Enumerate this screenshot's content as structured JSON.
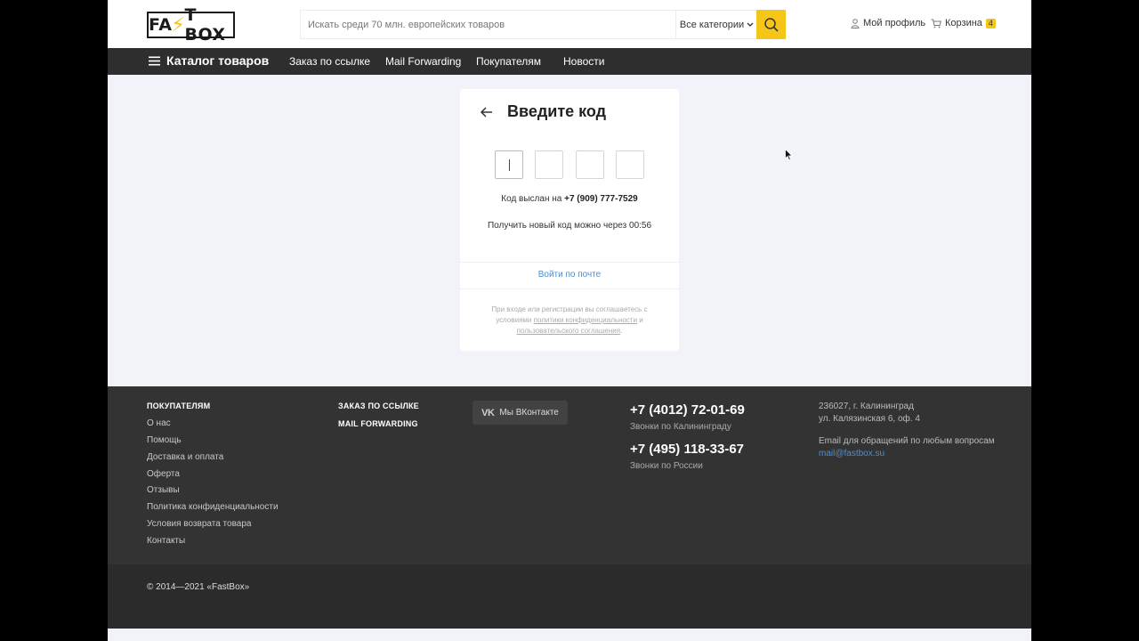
{
  "header": {
    "logo_left": "FA",
    "logo_bolt": "⚡",
    "logo_right": "T BOX",
    "search_placeholder": "Искать среди 70 млн. европейских товаров",
    "category_select": "Все категории",
    "profile": "Мой профиль",
    "cart": "Корзина",
    "cart_count": "4"
  },
  "nav": {
    "catalog": "Каталог товаров",
    "items": [
      "Заказ по ссылке",
      "Mail Forwarding",
      "Покупателям",
      "Новости"
    ]
  },
  "card": {
    "title": "Введите код",
    "sent_prefix": "Код выслан на",
    "phone": "+7 (909) 777-7529",
    "timer_text": "Получить новый код можно через 00:56",
    "email_login": "Войти по почте",
    "terms_1": "При входе или регистрации вы соглашаетесь с условиями",
    "terms_privacy": "политики конфиденциальности",
    "terms_and": "и",
    "terms_agreement": "пользовательского соглашения",
    "terms_end": "."
  },
  "footer": {
    "buyers_title": "ПОКУПАТЕЛЯМ",
    "buyers_links": [
      "О нас",
      "Помощь",
      "Доставка и оплата",
      "Оферта",
      "Отзывы",
      "Политика конфиденциальности",
      "Условия возврата товара",
      "Контакты"
    ],
    "order_title": "ЗАКАЗ ПО ССЫЛКЕ",
    "mail_title": "MAIL FORWARDING",
    "vk_mark": "VK",
    "vk_label": "Мы ВКонтакте",
    "phone_1": "+7 (4012) 72-01-69",
    "phone_1_note": "Звонки по Калининграду",
    "phone_2": "+7 (495) 118-33-67",
    "phone_2_note": "Звонки по России",
    "address_1": "236027, г. Калининград",
    "address_2": "ул. Калязинская 6, оф. 4",
    "email_note": "Email для обращений по любым вопросам",
    "email": "mail@fastbox.su",
    "copyright": "© 2014—2021 «FastBox»"
  },
  "colors": {
    "accent": "#f5c518",
    "nav_bg": "#2e2e2e",
    "footer_bg": "#333333",
    "link": "#4a8fd4"
  }
}
